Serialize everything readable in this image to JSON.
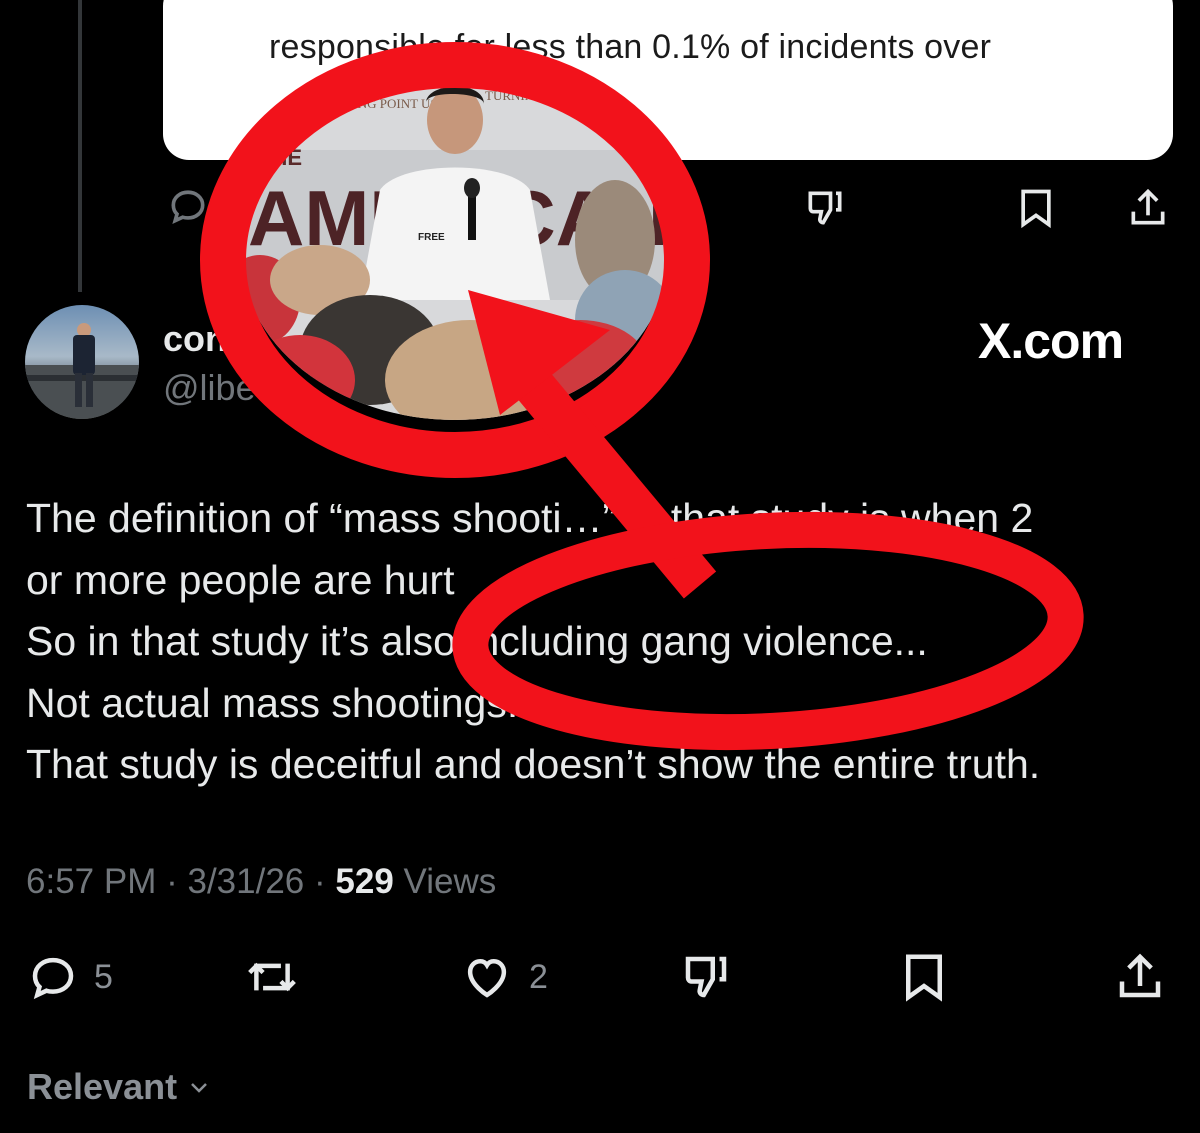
{
  "quote": {
    "text": "responsible for less than 0.1% of incidents over"
  },
  "quote_actions": {
    "reply_icon": "reply-icon",
    "dislike_icon": "dislike-icon",
    "bookmark_icon": "bookmark-icon",
    "share_icon": "share-icon"
  },
  "author": {
    "display_name": "con",
    "handle": "@libe"
  },
  "watermark": "X.com",
  "photo": {
    "banner_logo_left": "TURNING POINT USA",
    "banner_logo_right": "TURNING POINT USA",
    "banner_big_text": "AMERICAN",
    "banner_prefix": "THE",
    "shirt_text": "FREE"
  },
  "tweet": {
    "lines": [
      "The definition of “mass shooti…” in that study is when 2",
      "or more people are hurt",
      "So in that study it’s also including gang violence...",
      "Not actual mass shootings...",
      "That study is deceitful and doesn’t show the entire truth."
    ]
  },
  "meta": {
    "time": "6:57 PM",
    "date": "3/31/26",
    "views_count": "529",
    "views_label": "Views",
    "separator": "·"
  },
  "actions": {
    "reply_count": "5",
    "like_count": "2"
  },
  "sort": {
    "label": "Relevant"
  },
  "colors": {
    "background": "#000000",
    "text": "#e7e9ea",
    "muted": "#71767b",
    "overlay_red": "#f2121b"
  }
}
